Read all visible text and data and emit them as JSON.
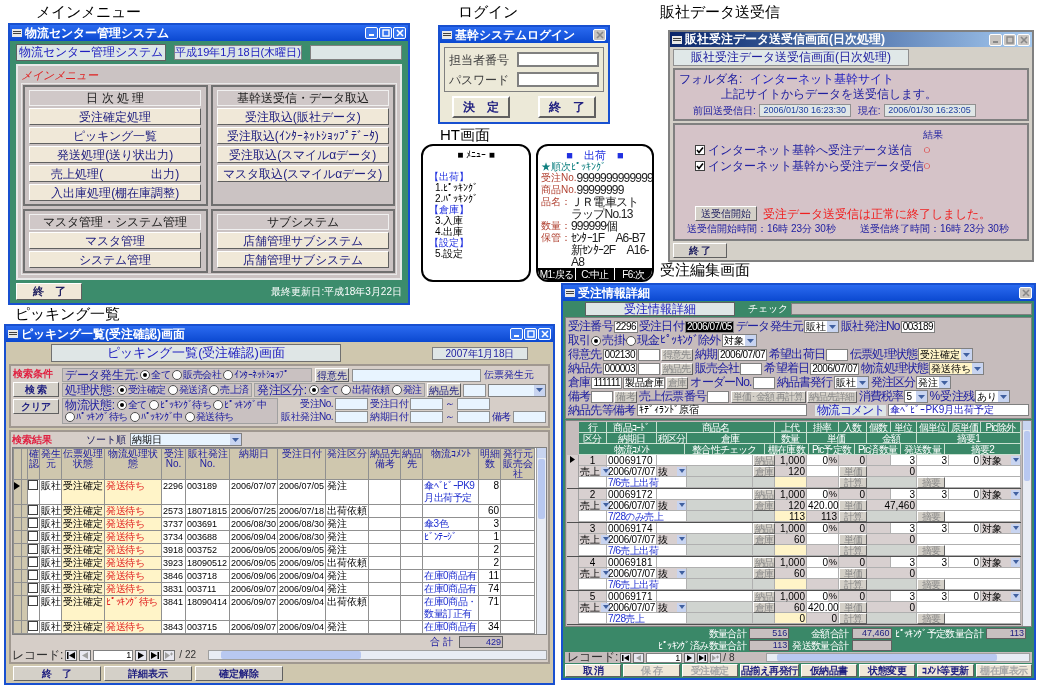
{
  "main_menu": {
    "caption": "メインメニュー",
    "window_title": "物流センター管理システム",
    "system_name": "物流センター管理システム",
    "date": "平成19年1月18日(木曜日)",
    "menu_label": "メインメニュー",
    "groups": [
      {
        "title": "日 次 処 理",
        "buttons": [
          "受注確定処理",
          "ピッキング一覧",
          "発送処理(送り状出力)",
          "売上処理(　　　　出力)",
          "入出庫処理(棚在庫調整)"
        ]
      },
      {
        "title": "基幹送受信・データ取込",
        "buttons": [
          "受注取込(販社データ)",
          "受注取込(ｲﾝﾀｰﾈｯﾄｼｮｯﾌﾟﾃﾞｰﾀ)",
          "受注取込(スマイルαデータ)",
          "マスタ取込(スマイルαデータ)"
        ]
      },
      {
        "title": "マスタ管理・システム管理",
        "buttons": [
          "マスタ管理",
          "システム管理"
        ]
      },
      {
        "title": "サブシステム",
        "buttons": [
          "店舗管理サブシステム",
          "店舗管理サブシステム"
        ]
      }
    ],
    "exit_button": "終　了",
    "last_updated": "最終更新日:平成18年3月22日"
  },
  "login": {
    "caption": "ログイン",
    "window_title": "基幹システムログイン",
    "fields": [
      {
        "label": "担当者番号"
      },
      {
        "label": "パスワード"
      }
    ],
    "buttons": [
      "決　定",
      "終　了"
    ]
  },
  "ht": {
    "caption": "HT画面",
    "menu_screen": {
      "title": "■ ﾒﾆｭｰ ■",
      "sections": [
        {
          "heading": "【出荷】",
          "items": [
            "1.ﾋﾟｯｷﾝｸﾞ",
            "2.ﾊﾟｯｷﾝｸﾞ"
          ]
        },
        {
          "heading": "【倉庫】",
          "items": [
            "3.入庫",
            "4.出庫"
          ]
        },
        {
          "heading": "【設定】",
          "items": [
            "5.設定"
          ]
        }
      ]
    },
    "shipping_screen": {
      "title": "■　出荷　■",
      "mode": "★順次ﾋﾟｯｷﾝｸﾞ",
      "fields": [
        {
          "label": "受注No.",
          "lines": [
            "9999999999999"
          ]
        },
        {
          "label": "商品No.",
          "lines": [
            "99999999"
          ]
        },
        {
          "label": "品名：",
          "lines": [
            "ＪＲ電車ストラップNo.13"
          ]
        },
        {
          "label": "数量：",
          "lines": [
            "999999個"
          ]
        },
        {
          "label": "保管：",
          "lines": [
            "ｾﾝﾀｰ1F　A6-B7",
            "新ｾﾝﾀｰ2F　A16-A8"
          ]
        }
      ],
      "keys": [
        "M1:戻る",
        "C:中止",
        "F6:次"
      ]
    }
  },
  "dealer_transfer": {
    "caption": "販社データ送受信",
    "window_title": "販社受注データ送受信画面(日次処理)",
    "header": "販社受注データ送受信画面(日次処理)",
    "folder_label": "フォルダ名:",
    "folder_name": "インターネット基幹サイト",
    "description": "上記サイトからデータを送受信します。",
    "previous_label": "前回送受信日:",
    "previous_value": "2006/01/30 16:23:30",
    "current_label": "現在:",
    "current_value": "2006/01/30 16:23:05",
    "result_heading": "結果",
    "tasks": [
      {
        "label": "インターネット基幹へ受注データ送信",
        "checked": true,
        "result": "○"
      },
      {
        "label": "インターネット基幹から受注データ受信",
        "checked": true,
        "result": "○"
      }
    ],
    "start_button": "送受信開始",
    "message": "受注データ送受信は正常に終了しました。",
    "start_time": "送受信開始時間：16時 23分 30秒",
    "end_time": "送受信終了時間：16時 23分 30秒",
    "exit_button": "終 了"
  },
  "picking_list": {
    "caption": "ピッキング一覧",
    "window_title": "ピッキング一覧(受注確認)画面",
    "header": "ピッキング一覧(受注確認)画面",
    "date": "2007年1月18日",
    "search": {
      "label": "検索条件",
      "buttons": [
        "検 索",
        "クリア"
      ],
      "radio_groups": [
        {
          "label": "データ発生元:",
          "options": [
            {
              "label": "全て",
              "selected": true
            },
            {
              "label": "販売会社",
              "selected": false
            },
            {
              "label": "ｲﾝﾀｰﾈｯﾄｼｮｯﾌﾟ",
              "selected": false
            }
          ]
        },
        {
          "label": "処理状態:",
          "options": [
            {
              "label": "受注確定",
              "selected": true
            },
            {
              "label": "発送済",
              "selected": false
            },
            {
              "label": "売上済",
              "selected": false
            }
          ]
        },
        {
          "label": "発注区分:",
          "options": [
            {
              "label": "全て",
              "selected": true
            },
            {
              "label": "出荷依頼",
              "selected": false
            },
            {
              "label": "発注",
              "selected": false
            }
          ]
        },
        {
          "label": "物流状態:",
          "options": [
            {
              "label": "全て",
              "selected": true
            },
            {
              "label": "ﾋﾟｯｷﾝｸﾞ待ち",
              "selected": false
            },
            {
              "label": "ﾋﾟｯｷﾝｸﾞ中",
              "selected": false
            },
            {
              "label": "ﾊﾟｯｷﾝｸﾞ待ち",
              "selected": false
            },
            {
              "label": "ﾊﾟｯｷﾝｸﾞ中",
              "selected": false
            },
            {
              "label": "発送待ち",
              "selected": false
            }
          ]
        }
      ],
      "customer_button": "得意先",
      "delivery_button": "納品先",
      "slip_source_label": "伝票発生元",
      "order_no_label": "受注No.",
      "dealer_order_no_label": "販社発注No.",
      "order_date_label": "受注日付",
      "due_date_label": "納期日付",
      "range_mark": "～",
      "remarks_label": "備考"
    },
    "results_label": "検索結果",
    "sort_label": "ソート順",
    "sort_value": "納期日",
    "columns": [
      "確認",
      "発生元",
      "伝票処理状態",
      "物流処理状態",
      "受注No.",
      "販社発注No.",
      "納期日",
      "受注日付",
      "発注区分",
      "納品先備考",
      "納品先",
      "物流ｺﾒﾝﾄ",
      "明細数",
      "発行元販売会社"
    ],
    "rows": [
      {
        "selected": true,
        "checked": false,
        "source": "販社",
        "slip_status": "受注確定",
        "logistics_status": "発送待ち",
        "order_no": "2296",
        "dealer_order_no": "003189",
        "due_date": "2006/07/07",
        "order_date": "2006/07/05",
        "order_type": "発注",
        "comment": "傘ﾍﾞﾋﾞｰPK9月出荷予定",
        "detail_count": "8"
      },
      {
        "selected": false,
        "checked": false,
        "source": "販社",
        "slip_status": "受注確定",
        "logistics_status": "発送待ち",
        "order_no": "2573",
        "dealer_order_no": "18071815",
        "due_date": "2006/07/25",
        "order_date": "2006/07/18",
        "order_type": "出荷依頼",
        "detail_count": "60"
      },
      {
        "selected": false,
        "checked": false,
        "source": "販社",
        "slip_status": "受注確定",
        "logistics_status": "発送待ち",
        "order_no": "3737",
        "dealer_order_no": "003691",
        "due_date": "2006/08/30",
        "order_date": "2006/08/30",
        "order_type": "発注",
        "comment": "傘3色",
        "detail_count": "3"
      },
      {
        "selected": false,
        "checked": false,
        "source": "販社",
        "slip_status": "受注確定",
        "logistics_status": "発送待ち",
        "order_no": "3734",
        "dealer_order_no": "003688",
        "due_date": "2006/09/04",
        "order_date": "2006/08/30",
        "order_type": "発注",
        "comment": "ﾋﾞﾝﾃｰｼﾞ",
        "detail_count": "1"
      },
      {
        "selected": false,
        "checked": false,
        "source": "販社",
        "slip_status": "受注確定",
        "logistics_status": "発送待ち",
        "order_no": "3918",
        "dealer_order_no": "003752",
        "due_date": "2006/09/05",
        "order_date": "2006/09/05",
        "order_type": "発注",
        "detail_count": "2"
      },
      {
        "selected": false,
        "checked": false,
        "source": "販社",
        "slip_status": "受注確定",
        "logistics_status": "発送待ち",
        "order_no": "3923",
        "dealer_order_no": "18090512",
        "due_date": "2006/09/05",
        "order_date": "2006/09/05",
        "order_type": "出荷依頼",
        "detail_count": "2"
      },
      {
        "selected": false,
        "checked": false,
        "source": "販社",
        "slip_status": "受注確定",
        "logistics_status": "発送待ち",
        "order_no": "3846",
        "dealer_order_no": "003718",
        "due_date": "2006/09/06",
        "order_date": "2006/09/04",
        "order_type": "発注",
        "comment": "在庫0商品有",
        "detail_count": "11"
      },
      {
        "selected": false,
        "checked": false,
        "source": "販社",
        "slip_status": "受注確定",
        "logistics_status": "発送待ち",
        "order_no": "3831",
        "dealer_order_no": "003711",
        "due_date": "2006/09/07",
        "order_date": "2006/09/04",
        "order_type": "発注",
        "comment": "在庫0商品有",
        "detail_count": "74"
      },
      {
        "selected": false,
        "checked": false,
        "source": "販社",
        "slip_status": "受注確定",
        "logistics_status": "ﾋﾟｯｷﾝｸﾞ待ち",
        "order_no": "3841",
        "dealer_order_no": "18090414",
        "due_date": "2006/09/07",
        "order_date": "2006/09/04",
        "order_type": "出荷依頼",
        "comment": "在庫0商品・数量訂正有",
        "detail_count": "71"
      },
      {
        "selected": false,
        "checked": false,
        "source": "販社",
        "slip_status": "受注確定",
        "logistics_status": "発送待ち",
        "order_no": "3843",
        "dealer_order_no": "003715",
        "due_date": "2006/09/07",
        "order_date": "2006/09/04",
        "order_type": "発注",
        "comment": "在庫0商品有",
        "detail_count": "34"
      }
    ],
    "total_label": "合 計",
    "total_value": "429",
    "record_nav": {
      "label": "レコード:",
      "current": "1",
      "total": "/ 22"
    },
    "buttons": [
      "終　了",
      "詳細表示",
      "確定解除"
    ]
  },
  "order_edit": {
    "caption": "受注編集画面",
    "window_title": "受注情報詳細",
    "header": "受注情報詳細",
    "check_label": "チェック",
    "field_rows": [
      [
        [
          {
            "kind": "field",
            "label": "受注番号",
            "value": "2296",
            "highlight": false
          },
          {
            "kind": "field",
            "label": "受注日付",
            "value": "2006/07/05",
            "highlight": true
          }
        ],
        [
          {
            "kind": "dropdown",
            "label": "データ発生元",
            "value": "販社",
            "highlight": false
          }
        ],
        [
          {
            "kind": "field",
            "label": "販社発注No",
            "value": "003189",
            "highlight": false
          }
        ],
        [
          {
            "kind": "radio",
            "label": "取引",
            "options": [
              {
                "label": "売掛",
                "selected": true
              },
              {
                "label": "現金",
                "selected": false
              }
            ]
          },
          {
            "kind": "dropdown",
            "label": "ﾋﾟｯｷﾝｸﾞ除外",
            "value": "対象",
            "highlight": false
          }
        ]
      ],
      [
        [
          {
            "kind": "field",
            "label": "得意先",
            "value": "002130",
            "highlight": false
          },
          {
            "kind": "field",
            "highlight": false
          },
          {
            "kind": "button",
            "label": "得意先"
          }
        ],
        [
          {
            "kind": "field",
            "label": "納期",
            "value": "2006/07/07",
            "highlight": false
          }
        ],
        [
          {
            "kind": "field",
            "label": "希望出荷日",
            "highlight": false
          }
        ],
        [
          {
            "kind": "dropdown",
            "label": "伝票処理状態",
            "value": "受注確定",
            "highlight": true
          }
        ]
      ],
      [
        [
          {
            "kind": "field",
            "label": "納品先",
            "value": "000003",
            "highlight": false
          },
          {
            "kind": "field",
            "highlight": false
          },
          {
            "kind": "button",
            "label": "納品先"
          }
        ],
        [
          {
            "kind": "field",
            "label": "販売会社",
            "highlight": false
          }
        ],
        [
          {
            "kind": "field",
            "label": "希望着日",
            "value": "2006/07/07",
            "highlight": false
          }
        ],
        [
          {
            "kind": "dropdown",
            "label": "物流処理状態",
            "value": "発送待ち",
            "highlight": true
          }
        ]
      ],
      [
        [
          {
            "kind": "field",
            "label": "倉庫",
            "value": "111111",
            "highlight": false
          },
          {
            "kind": "field",
            "value": "製品倉庫",
            "highlight": false
          },
          {
            "kind": "button",
            "label": "倉庫"
          }
        ],
        [
          {
            "kind": "field",
            "label": "オーダーNo.",
            "highlight": false
          }
        ],
        [
          {
            "kind": "dropdown",
            "label": "納品書発行",
            "value": "販社",
            "highlight": false
          }
        ],
        [
          {
            "kind": "dropdown",
            "label": "発注区分",
            "value": "発注",
            "highlight": false
          }
        ]
      ],
      [
        [
          {
            "kind": "field",
            "label": "備考",
            "highlight": false
          },
          {
            "kind": "button",
            "label": "備考"
          }
        ],
        [
          {
            "kind": "field",
            "label": "売上伝票番号",
            "highlight": false
          }
        ],
        [
          {
            "kind": "button",
            "label": "単価･金額 再計算"
          },
          {
            "kind": "button",
            "label": "納品先詳細"
          }
        ],
        [
          {
            "kind": "dropdown",
            "label": "消費税率",
            "value": "5",
            "highlight": false
          },
          {
            "kind": "text",
            "label": "%"
          },
          {
            "kind": "dropdown",
            "label": "受注残",
            "value": "あり",
            "highlight": false
          }
        ]
      ]
    ],
    "note_label": "納品先等備考",
    "note_value": "ｷﾃﾞｨﾗﾝﾄﾞ原宿",
    "comment_label": "物流コメント",
    "comment_value": "傘ﾍﾞﾋﾞｰPK9月出荷予定",
    "header_rows": [
      [
        "行",
        "商品ｺｰﾄﾞ",
        "商品名",
        "上代",
        "掛率",
        "入数",
        "個数",
        "単位",
        "個単位",
        "原単価",
        "Pic除外"
      ],
      [
        "区分",
        "納期日",
        "税区分",
        "倉庫",
        "数量",
        "単価",
        "金額",
        "摘要1"
      ],
      [
        "物流ｺﾒﾝﾄ",
        "整合性チェック",
        "棚在庫数",
        "Pic予定数",
        "Pic済数量",
        "発送数量",
        "摘要2"
      ]
    ],
    "items": [
      {
        "selected": true,
        "line": "1",
        "code": "00069170",
        "list_price": "1,000",
        "rate": "0",
        "rate_unit": "%",
        "inner_qty": "0",
        "unit": "3",
        "unit_qty": "3",
        "cost": "0",
        "pick_exclude": "対象",
        "category": "売上",
        "due_date": "2006/07/07",
        "tax": "抜",
        "quantity": "120",
        "amount": "0",
        "comment": "7/6売上出荷",
        "buttons": [
          "納品",
          "倉庫",
          "単価",
          "計算",
          "摘要"
        ]
      },
      {
        "selected": false,
        "line": "2",
        "code": "00069172",
        "list_price": "1,000",
        "rate": "0",
        "rate_unit": "%",
        "inner_qty": "0",
        "unit": "3",
        "unit_qty": "3",
        "cost": "0",
        "pick_exclude": "対象",
        "category": "売上",
        "due_date": "2006/07/07",
        "tax": "抜",
        "quantity": "120",
        "price": "420.00",
        "amount": "47,460",
        "comment": "7/28のみ売上",
        "pick_planned": "113",
        "pick_done": "113",
        "buttons": [
          "納品",
          "倉庫",
          "単価",
          "計算",
          "摘要"
        ]
      },
      {
        "selected": false,
        "line": "3",
        "code": "00069174",
        "list_price": "1,000",
        "rate": "0",
        "rate_unit": "%",
        "inner_qty": "0",
        "unit": "3",
        "unit_qty": "3",
        "cost": "0",
        "pick_exclude": "対象",
        "category": "売上",
        "due_date": "2006/07/07",
        "tax": "抜",
        "quantity": "60",
        "amount": "0",
        "comment": "7/6売上出荷",
        "buttons": [
          "納品",
          "倉庫",
          "単価",
          "計算",
          "摘要"
        ]
      },
      {
        "selected": false,
        "line": "4",
        "code": "00069181",
        "list_price": "1,000",
        "rate": "0",
        "rate_unit": "%",
        "inner_qty": "0",
        "unit": "3",
        "unit_qty": "3",
        "cost": "0",
        "pick_exclude": "対象",
        "category": "売上",
        "due_date": "2006/07/07",
        "tax": "抜",
        "quantity": "60",
        "amount": "0",
        "comment": "7/6売上出荷",
        "buttons": [
          "納品",
          "倉庫",
          "単価",
          "計算",
          "摘要"
        ]
      },
      {
        "selected": false,
        "line": "5",
        "code": "00069171",
        "list_price": "1,000",
        "rate": "0",
        "rate_unit": "%",
        "inner_qty": "0",
        "unit": "3",
        "unit_qty": "3",
        "cost": "0",
        "pick_exclude": "対象",
        "category": "売上",
        "due_date": "2006/07/07",
        "tax": "抜",
        "quantity": "60",
        "price": "420.00",
        "amount": "0",
        "comment": "7/28売上",
        "pick_planned": "0",
        "pick_done": "0",
        "buttons": [
          "納品",
          "倉庫",
          "単価",
          "計算",
          "摘要"
        ]
      }
    ],
    "totals": [
      {
        "label": "数量合計",
        "value": "516"
      },
      {
        "label": "金額合計",
        "value": "47,460"
      },
      {
        "label": "ﾋﾟｯｷﾝｸﾞ予定数量合計",
        "value": "113"
      },
      {
        "label": "ﾋﾟｯｷﾝｸﾞ済み数量合計",
        "value": "113"
      },
      {
        "label": "発送数量合計"
      }
    ],
    "record_nav": {
      "label": "レコード:",
      "current": "1",
      "total": "/ 8"
    },
    "buttons": [
      {
        "label": "取 消",
        "disabled": false
      },
      {
        "label": "保 存",
        "disabled": true
      },
      {
        "label": "受注確定",
        "disabled": true
      },
      {
        "label": "品揃え再発行",
        "disabled": false
      },
      {
        "label": "仮納品書",
        "disabled": false
      },
      {
        "label": "状態変更",
        "disabled": false
      },
      {
        "label": "ｺﾒﾝﾄ等更新",
        "disabled": false
      },
      {
        "label": "棚在庫表示",
        "disabled": true
      }
    ]
  }
}
